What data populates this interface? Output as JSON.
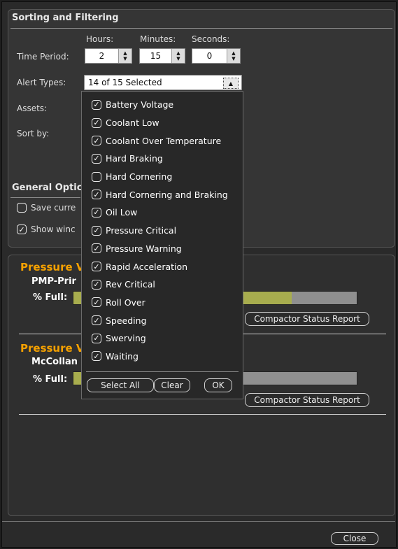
{
  "sorting": {
    "title": "Sorting and Filtering",
    "hours_label": "Hours:",
    "minutes_label": "Minutes:",
    "seconds_label": "Seconds:",
    "time_period_label": "Time Period:",
    "hours_value": "2",
    "minutes_value": "15",
    "seconds_value": "0",
    "alert_types_label": "Alert Types:",
    "alert_types_value": "14 of 15 Selected",
    "assets_label": "Assets:",
    "sort_by_label": "Sort by:"
  },
  "general": {
    "title": "General Optic",
    "option1": "Save curre",
    "option1_checked": false,
    "option2": "Show winc",
    "option2_checked": true
  },
  "popup": {
    "items": [
      {
        "label": "Battery Voltage",
        "checked": true
      },
      {
        "label": "Coolant Low",
        "checked": true
      },
      {
        "label": "Coolant Over Temperature",
        "checked": true
      },
      {
        "label": "Hard Braking",
        "checked": true
      },
      {
        "label": "Hard Cornering",
        "checked": false
      },
      {
        "label": "Hard Cornering and Braking",
        "checked": true
      },
      {
        "label": "Oil Low",
        "checked": true
      },
      {
        "label": "Pressure Critical",
        "checked": true
      },
      {
        "label": "Pressure Warning",
        "checked": true
      },
      {
        "label": "Rapid Acceleration",
        "checked": true
      },
      {
        "label": "Rev Critical",
        "checked": true
      },
      {
        "label": "Roll Over",
        "checked": true
      },
      {
        "label": "Speeding",
        "checked": true
      },
      {
        "label": "Swerving",
        "checked": true
      },
      {
        "label": "Waiting",
        "checked": true
      }
    ],
    "select_all_label": "Select All",
    "clear_label": "Clear",
    "ok_label": "OK"
  },
  "alerts": [
    {
      "title": "Pressure V",
      "asset": "PMP-Prir",
      "full_label": "% Full:",
      "fill_fraction": 0.77,
      "report_label": "Compactor Status Report"
    },
    {
      "title": "Pressure V",
      "asset": "McCollan",
      "full_label": "% Full:",
      "fill_fraction": 0.47,
      "report_label": "Compactor Status Report"
    }
  ],
  "footer": {
    "close_label": "Close"
  },
  "colors": {
    "accent_orange": "#f5a100",
    "bar_fill": "#a8ad4e",
    "bar_track": "#8f8f8f"
  }
}
